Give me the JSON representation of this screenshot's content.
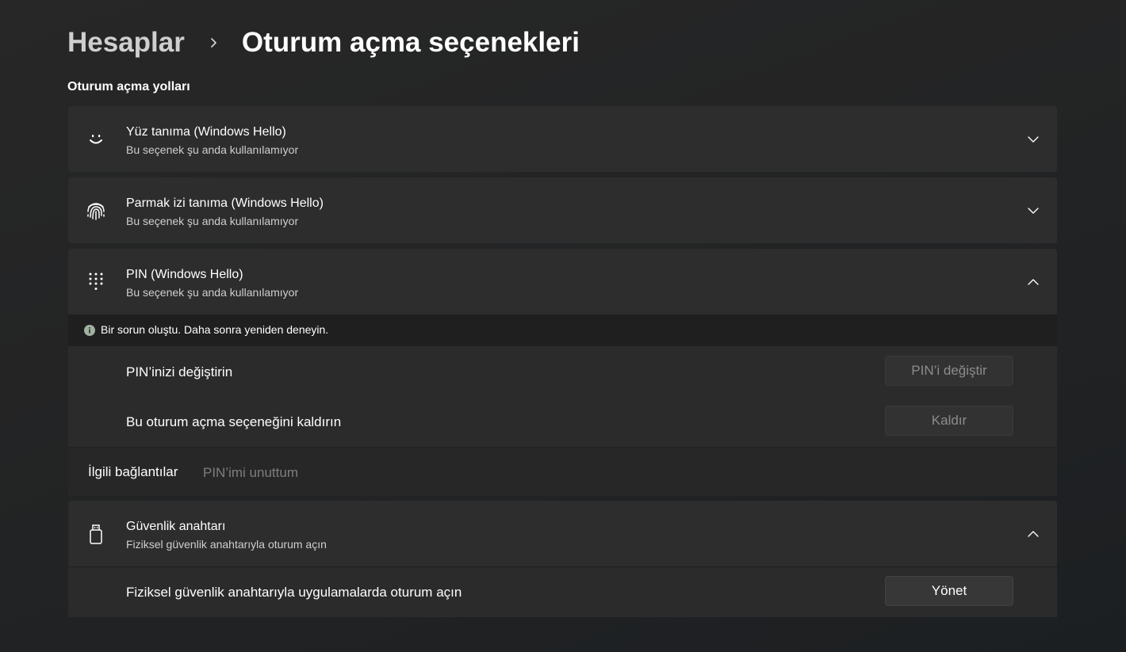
{
  "breadcrumb": {
    "parent": "Hesaplar",
    "current": "Oturum açma seçenekleri"
  },
  "section_title": "Oturum açma yolları",
  "options": [
    {
      "icon": "face-icon",
      "title": "Yüz tanıma (Windows Hello)",
      "subtitle": "Bu seçenek şu anda kullanılamıyor",
      "expanded": false
    },
    {
      "icon": "fingerprint-icon",
      "title": "Parmak izi tanıma (Windows Hello)",
      "subtitle": "Bu seçenek şu anda kullanılamıyor",
      "expanded": false
    },
    {
      "icon": "pin-keypad-icon",
      "title": "PIN (Windows Hello)",
      "subtitle": "Bu seçenek şu anda kullanılamıyor",
      "expanded": true,
      "error_message": "Bir sorun oluştu. Daha sonra yeniden deneyin.",
      "rows": [
        {
          "label": "PIN’inizi değiştirin",
          "button": "PIN’i değiştir",
          "enabled": false
        },
        {
          "label": "Bu oturum açma seçeneğini kaldırın",
          "button": "Kaldır",
          "enabled": false
        }
      ],
      "related": {
        "label": "İlgili bağlantılar",
        "link": "PIN’imi unuttum"
      }
    },
    {
      "icon": "usb-key-icon",
      "title": "Güvenlik anahtarı",
      "subtitle": "Fiziksel güvenlik anahtarıyla oturum açın",
      "expanded": true,
      "rows": [
        {
          "label": "Fiziksel güvenlik anahtarıyla uygulamalarda oturum açın",
          "button": "Yönet",
          "enabled": true
        }
      ]
    }
  ],
  "colors": {
    "background": "#222324",
    "card": "#2d2d2d",
    "error_icon": "#9fb29f",
    "disabled_text": "#8c8c8c"
  }
}
